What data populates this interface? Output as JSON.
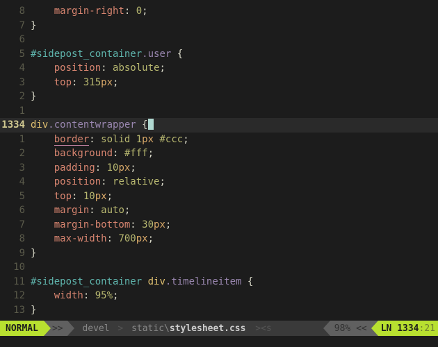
{
  "lines": [
    {
      "num": "8",
      "tokens": [
        {
          "t": "    ",
          "c": "c-white"
        },
        {
          "t": "margin-right",
          "c": "c-coral"
        },
        {
          "t": ": ",
          "c": "c-white"
        },
        {
          "t": "0",
          "c": "c-olive"
        },
        {
          "t": ";",
          "c": "c-white"
        }
      ]
    },
    {
      "num": "7",
      "tokens": [
        {
          "t": "}",
          "c": "c-white"
        }
      ]
    },
    {
      "num": "6",
      "tokens": []
    },
    {
      "num": "5",
      "tokens": [
        {
          "t": "#sidepost_container",
          "c": "c-teal"
        },
        {
          "t": ".user",
          "c": "c-purple"
        },
        {
          "t": " {",
          "c": "c-white"
        }
      ]
    },
    {
      "num": "4",
      "tokens": [
        {
          "t": "    ",
          "c": "c-white"
        },
        {
          "t": "position",
          "c": "c-coral"
        },
        {
          "t": ": ",
          "c": "c-white"
        },
        {
          "t": "absolute",
          "c": "c-olive"
        },
        {
          "t": ";",
          "c": "c-white"
        }
      ]
    },
    {
      "num": "3",
      "tokens": [
        {
          "t": "    ",
          "c": "c-white"
        },
        {
          "t": "top",
          "c": "c-coral"
        },
        {
          "t": ": ",
          "c": "c-white"
        },
        {
          "t": "315",
          "c": "c-olive"
        },
        {
          "t": "px",
          "c": "c-orange"
        },
        {
          "t": ";",
          "c": "c-white"
        }
      ]
    },
    {
      "num": "2",
      "tokens": [
        {
          "t": "}",
          "c": "c-white"
        }
      ]
    },
    {
      "num": "1",
      "tokens": []
    },
    {
      "num": "1334",
      "gold": true,
      "current": true,
      "tokens": [
        {
          "t": "div",
          "c": "c-yellow"
        },
        {
          "t": ".contentwrapper",
          "c": "c-purple"
        },
        {
          "t": " {",
          "c": "c-white"
        }
      ],
      "cursor": true
    },
    {
      "num": "1",
      "tokens": [
        {
          "t": "    ",
          "c": "c-white"
        },
        {
          "t": "border",
          "c": "c-coral",
          "ul": true
        },
        {
          "t": ": ",
          "c": "c-white"
        },
        {
          "t": "solid ",
          "c": "c-olive"
        },
        {
          "t": "1",
          "c": "c-olive"
        },
        {
          "t": "px",
          "c": "c-orange"
        },
        {
          "t": " #ccc",
          "c": "c-olive"
        },
        {
          "t": ";",
          "c": "c-white"
        }
      ]
    },
    {
      "num": "2",
      "tokens": [
        {
          "t": "    ",
          "c": "c-white"
        },
        {
          "t": "background",
          "c": "c-coral"
        },
        {
          "t": ": ",
          "c": "c-white"
        },
        {
          "t": "#fff",
          "c": "c-olive"
        },
        {
          "t": ";",
          "c": "c-white"
        }
      ]
    },
    {
      "num": "3",
      "tokens": [
        {
          "t": "    ",
          "c": "c-white"
        },
        {
          "t": "padding",
          "c": "c-coral"
        },
        {
          "t": ": ",
          "c": "c-white"
        },
        {
          "t": "10",
          "c": "c-olive"
        },
        {
          "t": "px",
          "c": "c-orange"
        },
        {
          "t": ";",
          "c": "c-white"
        }
      ]
    },
    {
      "num": "4",
      "tokens": [
        {
          "t": "    ",
          "c": "c-white"
        },
        {
          "t": "position",
          "c": "c-coral"
        },
        {
          "t": ": ",
          "c": "c-white"
        },
        {
          "t": "relative",
          "c": "c-olive"
        },
        {
          "t": ";",
          "c": "c-white"
        }
      ]
    },
    {
      "num": "5",
      "tokens": [
        {
          "t": "    ",
          "c": "c-white"
        },
        {
          "t": "top",
          "c": "c-coral"
        },
        {
          "t": ": ",
          "c": "c-white"
        },
        {
          "t": "10",
          "c": "c-olive"
        },
        {
          "t": "px",
          "c": "c-orange"
        },
        {
          "t": ";",
          "c": "c-white"
        }
      ]
    },
    {
      "num": "6",
      "tokens": [
        {
          "t": "    ",
          "c": "c-white"
        },
        {
          "t": "margin",
          "c": "c-coral"
        },
        {
          "t": ": ",
          "c": "c-white"
        },
        {
          "t": "auto",
          "c": "c-olive"
        },
        {
          "t": ";",
          "c": "c-white"
        }
      ]
    },
    {
      "num": "7",
      "tokens": [
        {
          "t": "    ",
          "c": "c-white"
        },
        {
          "t": "margin-bottom",
          "c": "c-coral"
        },
        {
          "t": ": ",
          "c": "c-white"
        },
        {
          "t": "30",
          "c": "c-olive"
        },
        {
          "t": "px",
          "c": "c-orange"
        },
        {
          "t": ";",
          "c": "c-white"
        }
      ]
    },
    {
      "num": "8",
      "tokens": [
        {
          "t": "    ",
          "c": "c-white"
        },
        {
          "t": "max-width",
          "c": "c-coral"
        },
        {
          "t": ": ",
          "c": "c-white"
        },
        {
          "t": "700",
          "c": "c-olive"
        },
        {
          "t": "px",
          "c": "c-orange"
        },
        {
          "t": ";",
          "c": "c-white"
        }
      ]
    },
    {
      "num": "9",
      "tokens": [
        {
          "t": "}",
          "c": "c-white"
        }
      ]
    },
    {
      "num": "10",
      "tokens": []
    },
    {
      "num": "11",
      "tokens": [
        {
          "t": "#sidepost_container",
          "c": "c-teal"
        },
        {
          "t": " ",
          "c": "c-white"
        },
        {
          "t": "div",
          "c": "c-yellow"
        },
        {
          "t": ".timelineitem",
          "c": "c-purple"
        },
        {
          "t": " {",
          "c": "c-white"
        }
      ]
    },
    {
      "num": "12",
      "tokens": [
        {
          "t": "    ",
          "c": "c-white"
        },
        {
          "t": "width",
          "c": "c-coral"
        },
        {
          "t": ": ",
          "c": "c-white"
        },
        {
          "t": "95%",
          "c": "c-olive"
        },
        {
          "t": ";",
          "c": "c-white"
        }
      ]
    },
    {
      "num": "13",
      "tokens": [
        {
          "t": "}",
          "c": "c-white"
        }
      ]
    }
  ],
  "status": {
    "mode": "NORMAL",
    "branch_symbol": ">>",
    "branch": "devel",
    "path_sep": ">",
    "path_dir": "static\\",
    "path_file": "stylesheet.css",
    "right1": "><s",
    "percent": "98%",
    "ln_label": "LN ",
    "ln": "1334",
    "col_sep": ":",
    "col": "21"
  }
}
